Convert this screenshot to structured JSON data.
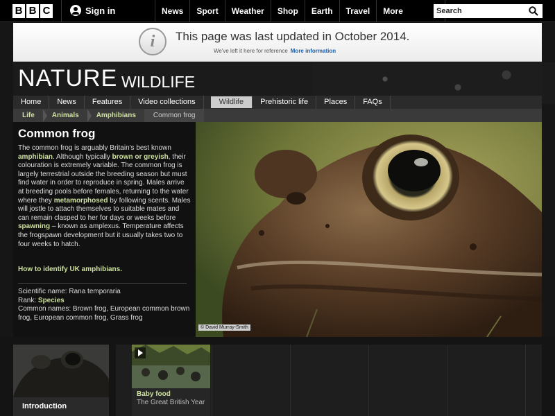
{
  "topbar": {
    "logo_letters": [
      "B",
      "B",
      "C"
    ],
    "signin_label": "Sign in",
    "nav": [
      "News",
      "Sport",
      "Weather",
      "Shop",
      "Earth",
      "Travel"
    ],
    "more_label": "More",
    "search_placeholder": "Search"
  },
  "notice": {
    "title": "This page was last updated in October 2014.",
    "subtitle": "We've left it here for reference",
    "link": "More information"
  },
  "header": {
    "title": "NATURE",
    "subtitle": "WILDLIFE"
  },
  "section_nav": {
    "items": [
      "Home",
      "News",
      "Features",
      "Video collections",
      "Wildlife",
      "Prehistoric life",
      "Places",
      "FAQs"
    ],
    "active": "Wildlife"
  },
  "breadcrumb": [
    "Life",
    "Animals",
    "Amphibians",
    "Common frog"
  ],
  "article": {
    "title": "Common frog",
    "body": {
      "p1": "The common frog is arguably Britain's best known ",
      "amphibian": "amphibian",
      "p2": ". Although typically ",
      "brown": "brown or greyish",
      "p3": ", their colouration is extremely variable. The common frog is largely terrestrial outside the breeding season but must find water in order to reproduce in spring. Males arrive at breeding pools before females, returning to the water where they ",
      "metamorphosed": "metamorphosed",
      "p4": " by following scents. Males will jostle to attach themselves to suitable mates and can remain clasped to her for days or weeks before ",
      "spawning": "spawning",
      "p5": " – known as amplexus. Temperature affects the frogspawn development but it usually takes two to four weeks to hatch."
    },
    "identify_link": "How to identify UK amphibians.",
    "facts": {
      "scientific": "Scientific name: Rana temporaria",
      "rank_label": "Rank: ",
      "rank_value": "Species",
      "common": "Common names: Brown frog, European common brown frog, European common frog, Grass frog"
    }
  },
  "photo": {
    "credit": "© David Murray-Smith"
  },
  "carousel": {
    "intro_label": "Introduction",
    "card_title": "Baby food",
    "card_subtitle": "The Great British Year"
  },
  "colors": {
    "accent_green": "#cde0a0",
    "link_blue": "#1f5faa"
  }
}
